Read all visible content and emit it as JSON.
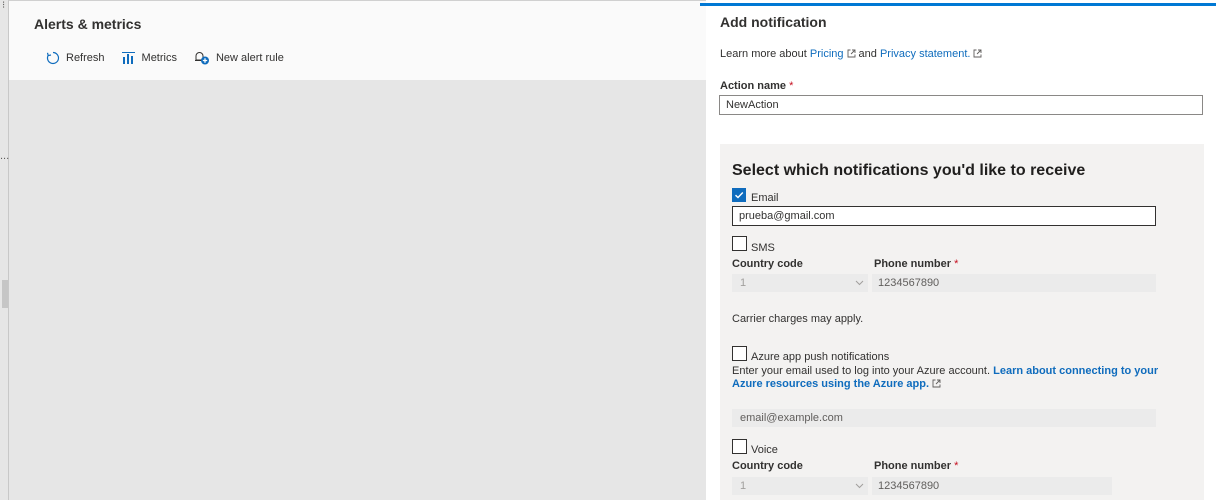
{
  "left": {
    "title": "Alerts & metrics",
    "toolbar": {
      "refresh_label": "Refresh",
      "metrics_label": "Metrics",
      "new_alert_label": "New alert rule"
    },
    "edge_ellipsis": "..."
  },
  "panel": {
    "title": "Add notification",
    "learn_prefix": "Learn more about",
    "pricing_link": "Pricing",
    "and_text": "and",
    "privacy_link": "Privacy statement.",
    "action_name_label": "Action name",
    "action_name_value": "NewAction",
    "required_marker": "*"
  },
  "notifications": {
    "heading": "Select which notifications you'd like to receive",
    "email": {
      "label": "Email",
      "checked": true,
      "value": "prueba@gmail.com"
    },
    "sms": {
      "label": "SMS",
      "checked": false,
      "country_code_label": "Country code",
      "country_code_value": "1",
      "phone_label": "Phone number",
      "phone_placeholder": "1234567890",
      "carrier_note": "Carrier charges may apply."
    },
    "push": {
      "label": "Azure app push notifications",
      "checked": false,
      "description": "Enter your email used to log into your Azure account.",
      "description_link": "Learn about connecting to your Azure resources using the Azure app.",
      "email_placeholder": "email@example.com"
    },
    "voice": {
      "label": "Voice",
      "checked": false,
      "country_code_label": "Country code",
      "country_code_value": "1",
      "phone_label": "Phone number",
      "phone_placeholder": "1234567890"
    }
  },
  "colors": {
    "accent": "#0078d4",
    "link": "#0f6cbd",
    "required": "#c50f1f"
  }
}
